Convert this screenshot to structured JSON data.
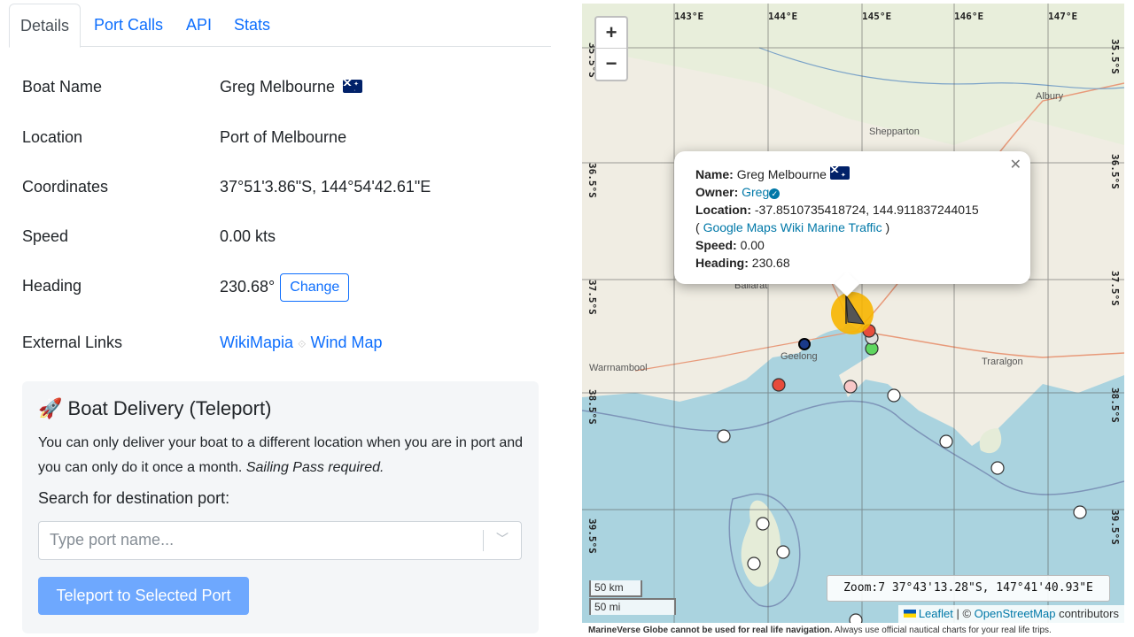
{
  "tabs": [
    "Details",
    "Port Calls",
    "API",
    "Stats"
  ],
  "details": {
    "boat_name_label": "Boat Name",
    "boat_name": "Greg Melbourne",
    "location_label": "Location",
    "location": "Port of Melbourne",
    "coordinates_label": "Coordinates",
    "coordinates": "37°51'3.86\"S, 144°54'42.61\"E",
    "speed_label": "Speed",
    "speed": "0.00 kts",
    "heading_label": "Heading",
    "heading": "230.68°",
    "change_label": "Change",
    "links_label": "External Links",
    "link_wikimapia": "WikiMapia",
    "link_windmap": "Wind Map"
  },
  "delivery": {
    "icon": "rocket-icon",
    "title": "Boat Delivery (Teleport)",
    "desc_1": "You can only deliver your boat to a different location when you are in port and you can only do it once a month. ",
    "desc_2": "Sailing Pass required.",
    "search_label": "Search for destination port:",
    "placeholder": "Type port name...",
    "button": "Teleport to Selected Port"
  },
  "map": {
    "lon_labels": [
      "143°E",
      "144°E",
      "145°E",
      "146°E",
      "147°E"
    ],
    "lat_labels": [
      "35.5°S",
      "36.5°S",
      "37.5°S",
      "38.5°S",
      "39.5°S"
    ],
    "towns": [
      "Albury",
      "Shepparton",
      "Ballarat",
      "Geelong",
      "Warrnambool",
      "Traralgon"
    ],
    "popup": {
      "name_label": "Name:",
      "name": "Greg Melbourne",
      "owner_label": "Owner:",
      "owner": "Greg",
      "location_label": "Location:",
      "location": "-37.8510735418724, 144.911837244015",
      "link_open": "( ",
      "link_gmaps": "Google Maps",
      "link_wiki": "Wiki",
      "link_marine": "Marine Traffic",
      "link_close": " )",
      "speed_label": "Speed:",
      "speed": "0.00",
      "heading_label": "Heading:",
      "heading": "230.68"
    },
    "scale_km": "50 km",
    "scale_mi": "50 mi",
    "zoom_info": "Zoom:7 37°43'13.28\"S, 147°41'40.93\"E",
    "attribution_leaflet": "Leaflet",
    "attribution_sep": " | © ",
    "attribution_osm": "OpenStreetMap",
    "attribution_tail": " contributors",
    "footer_bold": "MarineVerse Globe cannot be used for real life navigation.",
    "footer_rest": " Always use official nautical charts for your real life trips."
  }
}
